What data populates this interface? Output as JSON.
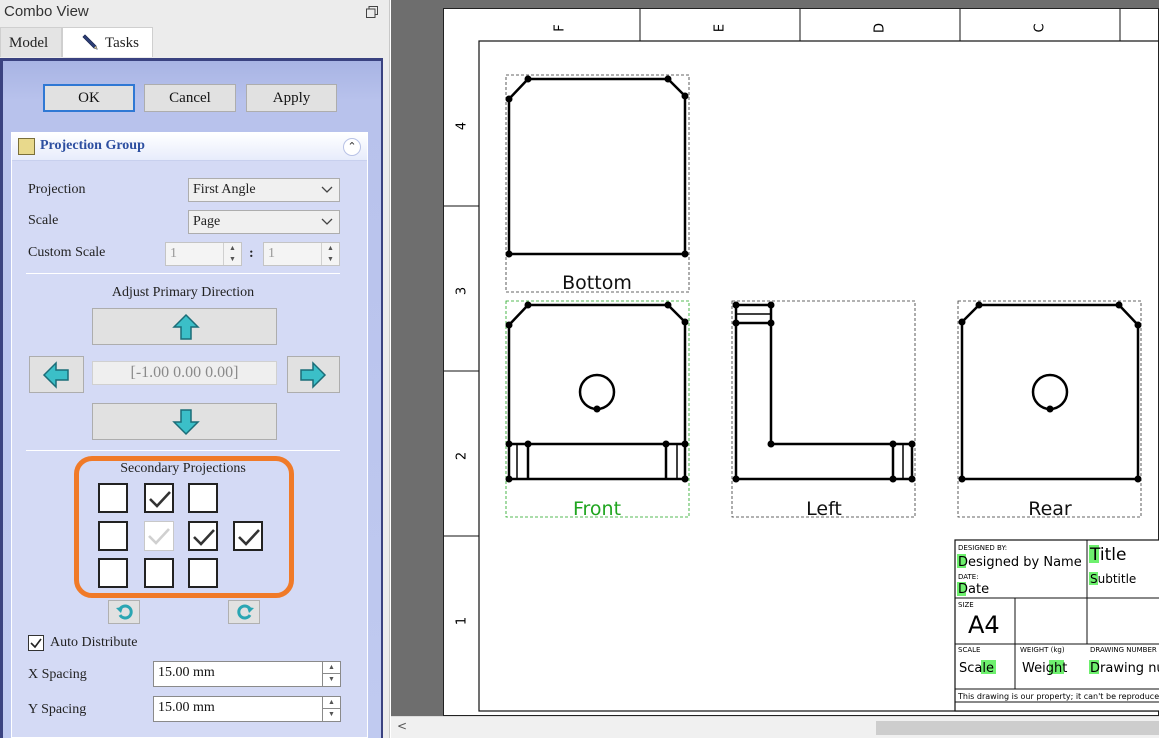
{
  "window": {
    "title": "Combo View"
  },
  "tabs": [
    {
      "label": "Model"
    },
    {
      "label": "Tasks"
    }
  ],
  "buttons": {
    "ok": "OK",
    "cancel": "Cancel",
    "apply": "Apply"
  },
  "panel": {
    "title": "Projection Group",
    "projection_label": "Projection",
    "projection_value": "First Angle",
    "scale_label": "Scale",
    "scale_value": "Page",
    "custom_scale_label": "Custom Scale",
    "custom_scale_num": "1",
    "custom_scale_sep": ":",
    "custom_scale_den": "1",
    "adjust_label": "Adjust Primary Direction",
    "direction_value": "[-1.00 0.00 0.00]",
    "secondary_label": "Secondary Projections",
    "secondary_checks": [
      [
        false,
        true,
        false,
        null
      ],
      [
        false,
        "dim",
        true,
        true
      ],
      [
        false,
        false,
        false,
        null
      ]
    ],
    "auto_distribute_label": "Auto Distribute",
    "auto_distribute_checked": true,
    "x_spacing_label": "X Spacing",
    "x_spacing_value": "15.00 mm",
    "y_spacing_label": "Y Spacing",
    "y_spacing_value": "15.00 mm"
  },
  "drawing": {
    "column_labels": [
      "F",
      "E",
      "D",
      "C"
    ],
    "row_labels": [
      "4",
      "3",
      "2",
      "1"
    ],
    "views": [
      {
        "name": "Bottom",
        "color": "#111111"
      },
      {
        "name": "Front",
        "color": "#1fa51f"
      },
      {
        "name": "Left",
        "color": "#111111"
      },
      {
        "name": "Rear",
        "color": "#111111"
      }
    ],
    "title_block": {
      "designed_by_label": "DESIGNED BY:",
      "designed_by_value": "Designed by Name",
      "date_label": "DATE:",
      "date_value": "Date",
      "title_value": "Title",
      "subtitle_value": "Subtitle",
      "size_label": "SIZE",
      "size_value": "A4",
      "scale_label": "SCALE",
      "scale_value": "Scale",
      "weight_label": "WEIGHT (kg)",
      "weight_value": "Weight",
      "drawing_number_label": "DRAWING NUMBER",
      "drawing_number_value": "Drawing nur",
      "footer": "This drawing is our property; it can't be reproduced or"
    }
  },
  "colors": {
    "accent": "#f07a28",
    "panel_bg": "#c0caf0",
    "header_text": "#2d4fa0",
    "front_highlight": "#1fa51f",
    "editable_highlight": "#6ef06e"
  }
}
